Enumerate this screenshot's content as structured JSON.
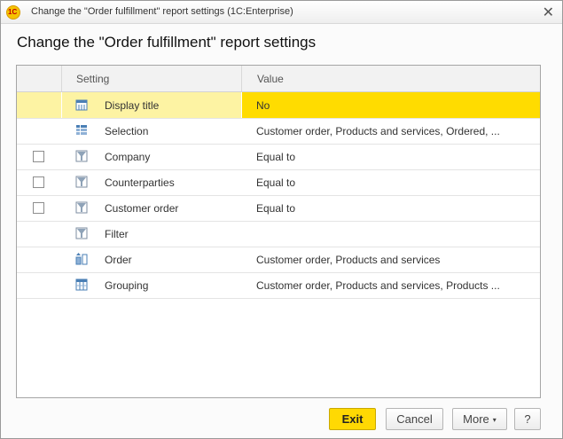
{
  "window": {
    "title": "Change the \"Order fulfillment\" report settings  (1C:Enterprise)",
    "logo_text": "1C",
    "close_symbol": "✕"
  },
  "heading": "Change the \"Order fulfillment\" report settings",
  "grid": {
    "columns": [
      "",
      "Setting",
      "Value"
    ],
    "rows": [
      {
        "checkbox": false,
        "icon": "title-icon",
        "setting": "Display title",
        "value": "No",
        "selected": true
      },
      {
        "checkbox": false,
        "icon": "selection-icon",
        "setting": "Selection",
        "value": "Customer order, Products and services, Ordered, ..."
      },
      {
        "checkbox": true,
        "icon": "filter-icon",
        "setting": "Company",
        "value": "Equal to"
      },
      {
        "checkbox": true,
        "icon": "filter-icon",
        "setting": "Counterparties",
        "value": "Equal to"
      },
      {
        "checkbox": true,
        "icon": "filter-icon",
        "setting": "Customer order",
        "value": "Equal to"
      },
      {
        "checkbox": false,
        "icon": "filter-icon",
        "setting": "Filter",
        "value": ""
      },
      {
        "checkbox": false,
        "icon": "order-icon",
        "setting": "Order",
        "value": "Customer order, Products and services"
      },
      {
        "checkbox": false,
        "icon": "grouping-icon",
        "setting": "Grouping",
        "value": "Customer order, Products and services, Products ..."
      }
    ]
  },
  "buttons": {
    "exit": "Exit",
    "cancel": "Cancel",
    "more": "More",
    "more_caret": "▾",
    "help": "?"
  },
  "colors": {
    "selected_row": "#fdf3a3",
    "selected_value": "#ffdc00",
    "primary_button": "#ffd903"
  }
}
